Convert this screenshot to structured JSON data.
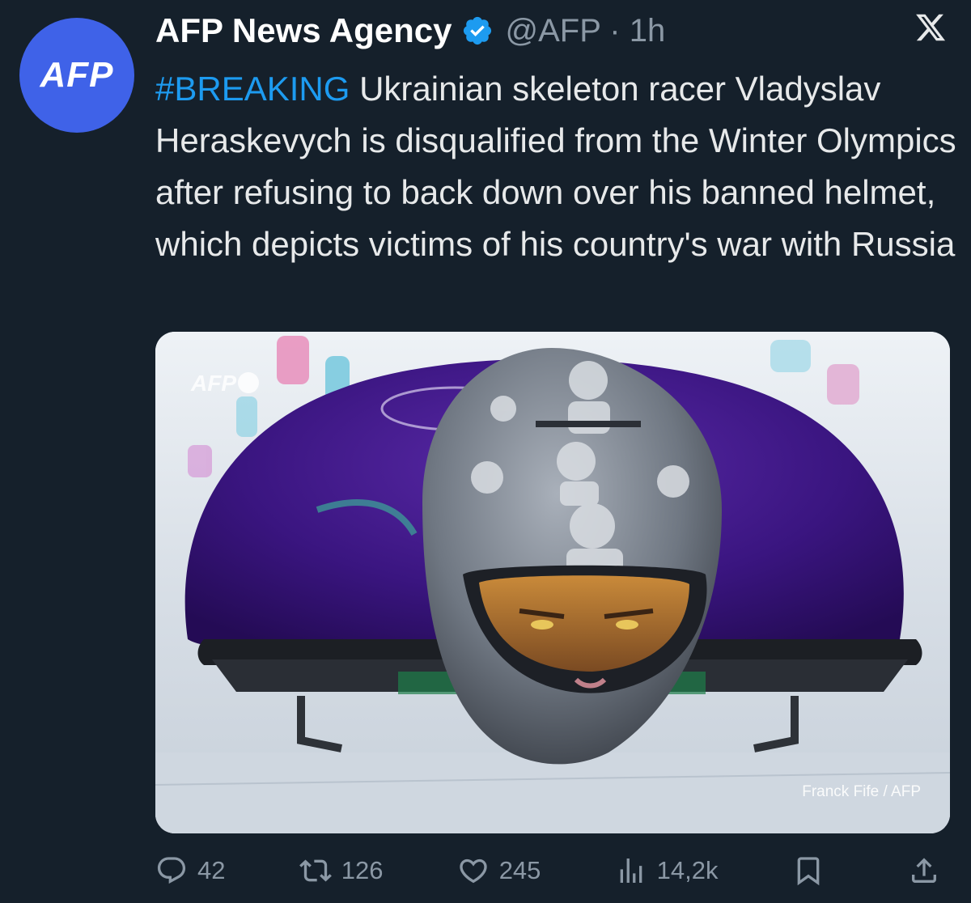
{
  "author": {
    "avatar_text": "AFP",
    "name": "AFP News Agency",
    "handle_time": "@AFP · 1h",
    "verified_icon": "verified-badge-icon"
  },
  "app": {
    "logo_icon": "x-logo-icon"
  },
  "tweet": {
    "hashtag": "#BREAKING",
    "body": " Ukrainian skeleton racer Vladyslav Heraskevych is disqualified from the Winter Olympics after refusing to back down over his banned helmet, which depicts victims of his country's war with Russia"
  },
  "media": {
    "watermark": "AFP",
    "credit": "Franck Fife / AFP"
  },
  "actions": {
    "replies": "42",
    "retweets": "126",
    "likes": "245",
    "views": "14,2k"
  },
  "colors": {
    "background": "#15202b",
    "accent": "#1d9bf0",
    "muted": "#8b98a5",
    "avatar": "#3f62e8"
  }
}
